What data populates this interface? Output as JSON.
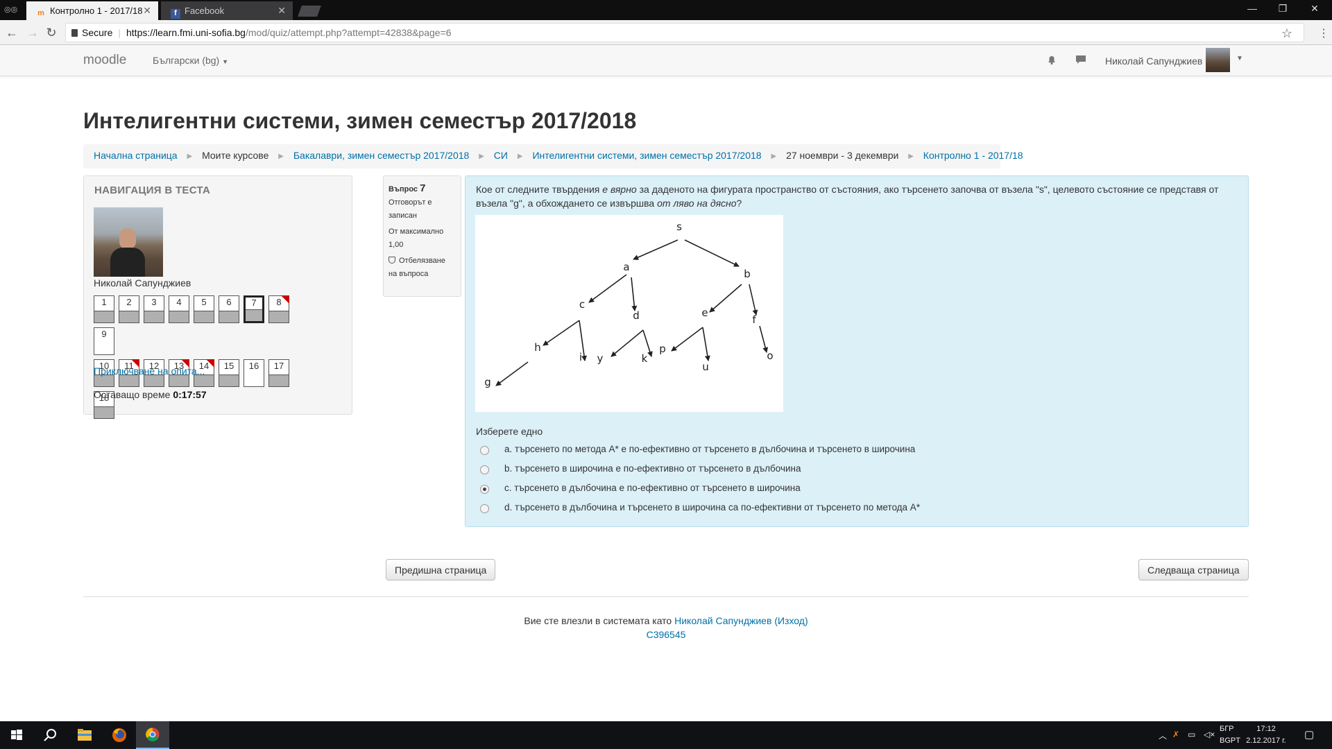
{
  "browser": {
    "tabs": [
      {
        "title": "Контролно 1 - 2017/18",
        "favicon": "moodle-icon",
        "active": true
      },
      {
        "title": "Facebook",
        "favicon": "facebook-icon",
        "active": false
      }
    ],
    "secure_label": "Secure",
    "url_host": "https://learn.fmi.uni-sofia.bg",
    "url_path": "/mod/quiz/attempt.php?attempt=42838&page=6"
  },
  "navbar": {
    "brand": "moodle",
    "language": "Български (bg)",
    "user_name": "Николай Сапунджиев"
  },
  "page": {
    "title": "Интелигентни системи, зимен семестър 2017/2018",
    "breadcrumb": [
      {
        "label": "Начална страница",
        "link": true
      },
      {
        "label": "Моите курсове",
        "link": false
      },
      {
        "label": "Бакалаври, зимен семестър 2017/2018",
        "link": true
      },
      {
        "label": "СИ",
        "link": true
      },
      {
        "label": "Интелигентни системи, зимен семестър 2017/2018",
        "link": true
      },
      {
        "label": "27 ноември - 3 декември",
        "link": false
      },
      {
        "label": "Контролно 1 - 2017/18",
        "link": true
      }
    ]
  },
  "quiz_nav": {
    "heading": "НАВИГАЦИЯ В ТЕСТА",
    "student_name": "Николай Сапунджиев",
    "questions": [
      {
        "n": "1",
        "answered": true,
        "flagged": false,
        "current": false
      },
      {
        "n": "2",
        "answered": true,
        "flagged": false,
        "current": false
      },
      {
        "n": "3",
        "answered": true,
        "flagged": false,
        "current": false
      },
      {
        "n": "4",
        "answered": true,
        "flagged": false,
        "current": false
      },
      {
        "n": "5",
        "answered": true,
        "flagged": false,
        "current": false
      },
      {
        "n": "6",
        "answered": true,
        "flagged": false,
        "current": false
      },
      {
        "n": "7",
        "answered": true,
        "flagged": false,
        "current": true
      },
      {
        "n": "8",
        "answered": true,
        "flagged": true,
        "current": false
      },
      {
        "n": "9",
        "answered": false,
        "flagged": false,
        "current": false
      },
      {
        "n": "10",
        "answered": true,
        "flagged": false,
        "current": false
      },
      {
        "n": "11",
        "answered": true,
        "flagged": true,
        "current": false
      },
      {
        "n": "12",
        "answered": true,
        "flagged": false,
        "current": false
      },
      {
        "n": "13",
        "answered": true,
        "flagged": true,
        "current": false
      },
      {
        "n": "14",
        "answered": true,
        "flagged": true,
        "current": false
      },
      {
        "n": "15",
        "answered": true,
        "flagged": false,
        "current": false
      },
      {
        "n": "16",
        "answered": false,
        "flagged": false,
        "current": false
      },
      {
        "n": "17",
        "answered": true,
        "flagged": false,
        "current": false
      },
      {
        "n": "18",
        "answered": true,
        "flagged": false,
        "current": false
      }
    ],
    "finish_link": "Приключване на опита...",
    "time_label": "Оставащо време",
    "time_value": "0:17:57"
  },
  "question": {
    "number_label": "Въпрос",
    "number": "7",
    "status_line1": "Отговорът е",
    "status_line2": "записан",
    "max_line1": "От максимално",
    "max_line2": "1,00",
    "flag_line1": "Отбелязване",
    "flag_line2": "на въпроса",
    "text_before_italic1": "Кое от следните твърдения ",
    "text_italic1": "е вярно",
    "text_after_italic1": " за даденото на фигурата пространство от състояния, ако търсенето започва от възела \"s\", целевото състояние се представя от възела \"g\", а обхождането се извършва ",
    "text_italic2": "от ляво на дясно",
    "text_end": "?",
    "tree_labels": [
      "s",
      "a",
      "b",
      "c",
      "d",
      "e",
      "f",
      "h",
      "i",
      "y",
      "k",
      "p",
      "u",
      "g",
      "o"
    ],
    "prompt": "Изберете едно",
    "options": [
      {
        "label": "a. търсенето по метода A* е по-ефективно от търсенето в дълбочина и търсенето в широчина",
        "selected": false
      },
      {
        "label": "b. търсенето в широчина е по-ефективно от търсенето в дълбочина",
        "selected": false
      },
      {
        "label": "c. търсенето в дълбочина е по-ефективно от търсенето в широчина",
        "selected": true
      },
      {
        "label": "d. търсенето в дълбочина и търсенето в широчина са по-ефективни от търсенето по метода A*",
        "selected": false
      }
    ]
  },
  "buttons": {
    "prev": "Предишна страница",
    "next": "Следваща страница"
  },
  "footer": {
    "logged_in_text": "Вие сте влезли в системата като ",
    "user_link": "Николай Сапунджиев",
    "logout_link": "(Изход)",
    "code": "C396545"
  },
  "taskbar": {
    "lang_top": "БГР",
    "lang_bottom": "BGPT",
    "time": "17:12",
    "date": "2.12.2017 г."
  }
}
